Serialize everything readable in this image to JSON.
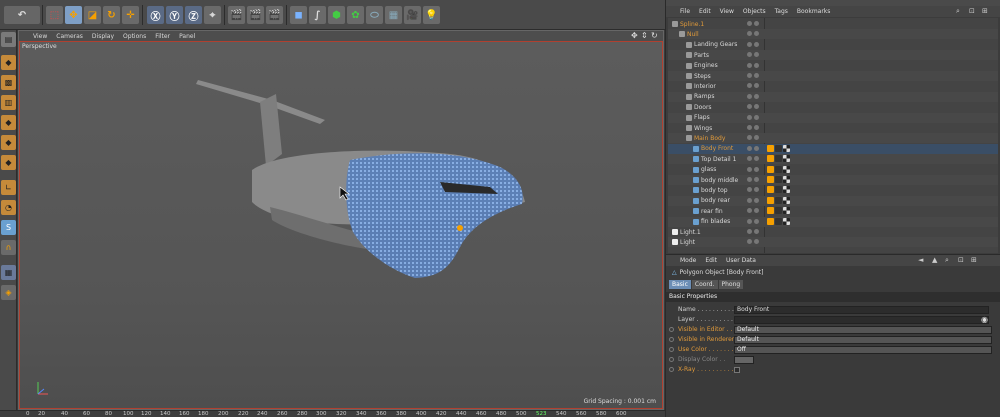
{
  "viewport": {
    "menu": [
      "View",
      "Cameras",
      "Display",
      "Options",
      "Filter",
      "Panel"
    ],
    "label": "Perspective",
    "grid_spacing": "Grid Spacing : 0.001 cm"
  },
  "ruler": {
    "ticks": [
      "0",
      "20",
      "40",
      "60",
      "80",
      "100",
      "120",
      "140",
      "160",
      "180",
      "200",
      "220",
      "240",
      "260",
      "280",
      "300",
      "320",
      "340",
      "360",
      "380",
      "400",
      "420",
      "440",
      "460",
      "480",
      "500",
      "523",
      "540",
      "560",
      "580",
      "600"
    ],
    "current": "523"
  },
  "object_manager": {
    "menu": [
      "File",
      "Edit",
      "View",
      "Objects",
      "Tags",
      "Bookmarks"
    ],
    "objects": [
      {
        "name": "Spline.1",
        "indent": 0,
        "color": "#e09a3a"
      },
      {
        "name": "Null",
        "indent": 1,
        "color": "#e09a3a"
      },
      {
        "name": "Landing Gears",
        "indent": 2,
        "color": "#d8d8d8"
      },
      {
        "name": "Parts",
        "indent": 2,
        "color": "#d8d8d8"
      },
      {
        "name": "Engines",
        "indent": 2,
        "color": "#d8d8d8"
      },
      {
        "name": "Steps",
        "indent": 2,
        "color": "#d8d8d8"
      },
      {
        "name": "Interior",
        "indent": 2,
        "color": "#d8d8d8"
      },
      {
        "name": "Ramps",
        "indent": 2,
        "color": "#d8d8d8"
      },
      {
        "name": "Doors",
        "indent": 2,
        "color": "#d8d8d8"
      },
      {
        "name": "Flaps",
        "indent": 2,
        "color": "#d8d8d8"
      },
      {
        "name": "Wings",
        "indent": 2,
        "color": "#d8d8d8"
      },
      {
        "name": "Main Body",
        "indent": 2,
        "color": "#e09a3a"
      },
      {
        "name": "Body Front",
        "indent": 3,
        "color": "#e09a3a"
      },
      {
        "name": "Top Detail 1",
        "indent": 3,
        "color": "#d8d8d8"
      },
      {
        "name": "glass",
        "indent": 3,
        "color": "#d8d8d8"
      },
      {
        "name": "body middle",
        "indent": 3,
        "color": "#d8d8d8"
      },
      {
        "name": "body top",
        "indent": 3,
        "color": "#d8d8d8"
      },
      {
        "name": "body rear",
        "indent": 3,
        "color": "#d8d8d8"
      },
      {
        "name": "rear fin",
        "indent": 3,
        "color": "#d8d8d8"
      },
      {
        "name": "fin blades",
        "indent": 3,
        "color": "#d8d8d8"
      },
      {
        "name": "Light.1",
        "indent": 0,
        "color": "#d8d8d8"
      },
      {
        "name": "Light",
        "indent": 0,
        "color": "#d8d8d8"
      }
    ]
  },
  "attribute_manager": {
    "menu": [
      "Mode",
      "Edit",
      "User Data"
    ],
    "title": "Polygon Object [Body Front]",
    "tabs": [
      "Basic",
      "Coord.",
      "Phong"
    ],
    "section": "Basic Properties",
    "name_label": "Name . . . . . . . . . . .",
    "name_value": "Body Front",
    "layer_label": "Layer . . . . . . . . . . .",
    "visible_editor_label": "Visible in Editor . . .",
    "visible_editor_value": "Default",
    "visible_renderer_label": "Visible in Renderer",
    "visible_renderer_value": "Default",
    "use_color_label": "Use Color . . . . . . .",
    "use_color_value": "Off",
    "display_color_label": "Display Color . .",
    "xray_label": "X-Ray . . . . . . . . . ."
  },
  "colors": {
    "accent_orange": "#e09a3a",
    "selection_blue": "#6b8db5",
    "viewport_border": "#b04030"
  }
}
